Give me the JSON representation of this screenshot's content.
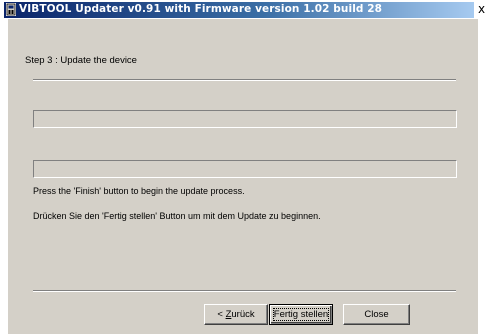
{
  "window": {
    "title": "VIBTOOL Updater v0.91 with Firmware version 1.02 build 28",
    "close_glyph": "x"
  },
  "step": {
    "title": "Step 3 : Update the device"
  },
  "progress": {
    "bar1_value": 0,
    "bar2_value": 0
  },
  "messages": {
    "english": "Press the 'Finish' button to begin the update process.",
    "german": "Drücken Sie den 'Fertig stellen' Button um mit dem Update zu beginnen."
  },
  "buttons": {
    "back_prefix": "< ",
    "back_mnemonic": "Z",
    "back_rest": "urück",
    "finish": "Fertig stellen",
    "close": "Close"
  },
  "icons": {
    "app": "app-icon",
    "close": "close-icon"
  },
  "colors": {
    "face": "#d4d0c8",
    "title_start": "#0a246a",
    "title_end": "#a6caf0"
  }
}
